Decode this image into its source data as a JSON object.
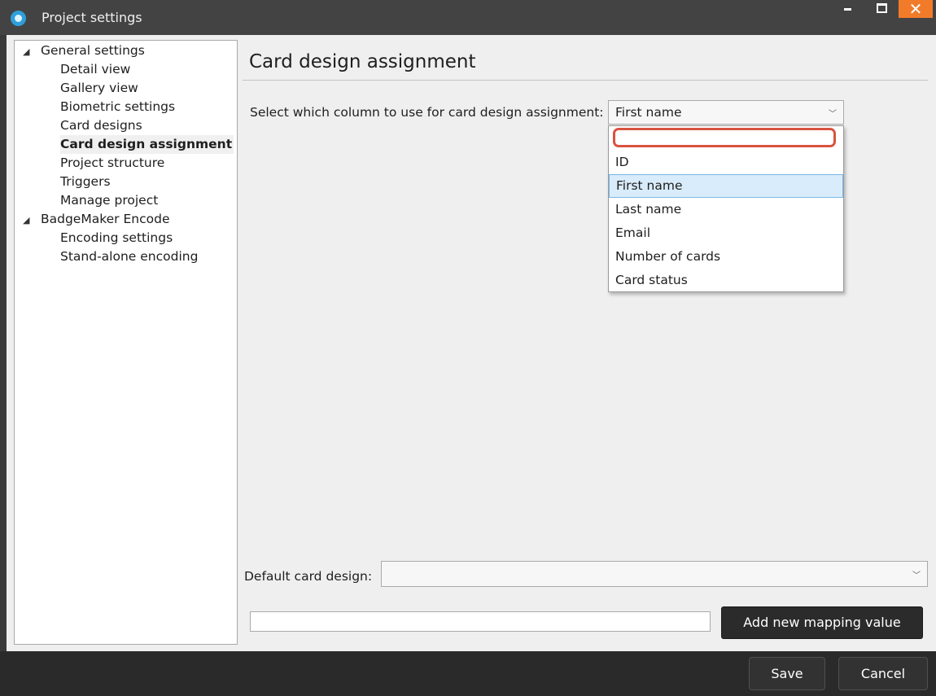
{
  "window": {
    "title": "Project settings",
    "close_glyph": "✕"
  },
  "tree": {
    "expand_glyph": "◢",
    "groups": [
      {
        "label": "General settings",
        "items": [
          {
            "label": "Detail view"
          },
          {
            "label": "Gallery view"
          },
          {
            "label": "Biometric settings"
          },
          {
            "label": "Card designs"
          },
          {
            "label": "Card design assignment",
            "selected": true
          },
          {
            "label": "Project structure"
          },
          {
            "label": "Triggers"
          },
          {
            "label": "Manage project"
          }
        ]
      },
      {
        "label": "BadgeMaker Encode",
        "items": [
          {
            "label": "Encoding settings"
          },
          {
            "label": "Stand-alone encoding"
          }
        ]
      }
    ]
  },
  "main": {
    "heading": "Card design assignment",
    "column_select": {
      "label": "Select which column to use for card design assignment:",
      "value": "First name",
      "filter_value": "",
      "options": [
        "ID",
        "First name",
        "Last name",
        "Email",
        "Number of cards",
        "Card status"
      ],
      "highlighted": "First name"
    },
    "default_design": {
      "label": "Default card design:",
      "value": ""
    },
    "mapping": {
      "input_value": "",
      "add_button": "Add new mapping value"
    }
  },
  "footer": {
    "save": "Save",
    "cancel": "Cancel"
  },
  "colors": {
    "title_bar": "#434343",
    "close_button": "#f27b2a",
    "filter_outline": "#d9533f",
    "highlight": "#d9ecfb",
    "footer": "#2a2a2a"
  },
  "icons": {
    "app": "app-logo-icon",
    "chevron": "chevron-down-icon"
  }
}
